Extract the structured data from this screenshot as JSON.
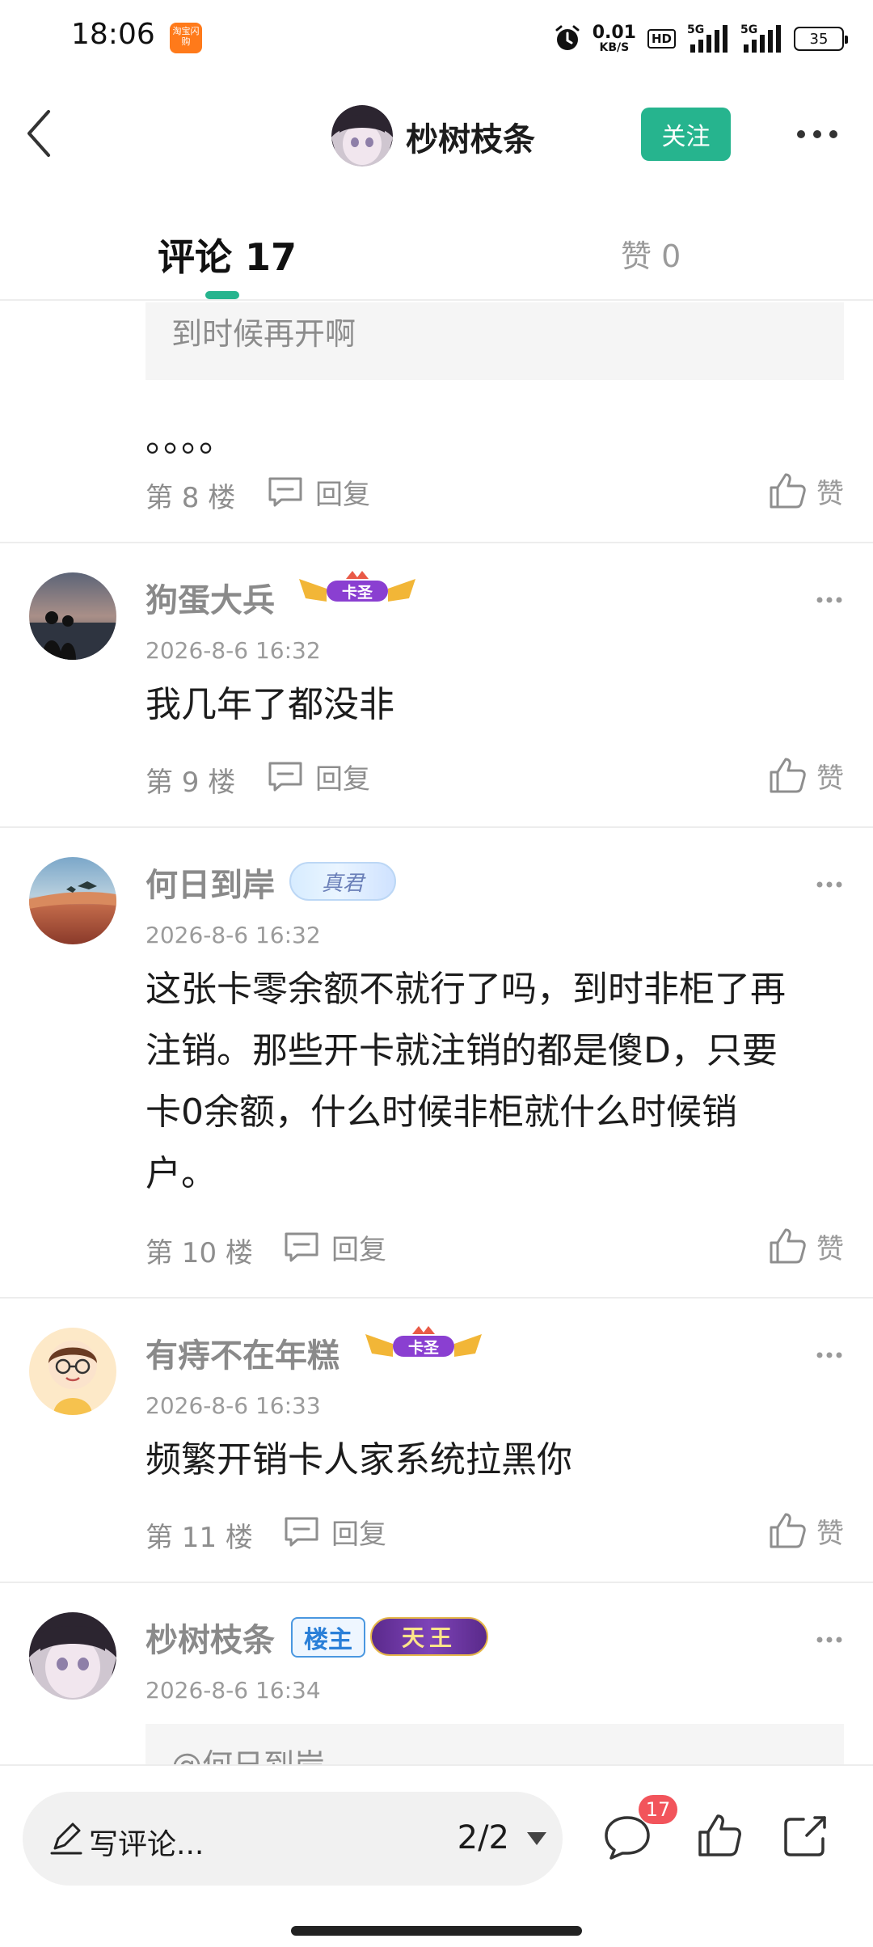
{
  "status_bar": {
    "time": "18:06",
    "app_icon_text": "淘宝闪购",
    "net_speed_value": "0.01",
    "net_speed_unit": "KB/S",
    "hd_label": "HD",
    "signal_1_label": "5G",
    "signal_2_label": "5G",
    "battery": "35"
  },
  "navbar": {
    "title": "杪树枝条",
    "follow_label": "关注"
  },
  "tabs": {
    "comments_label": "评论 17",
    "likes_label": "赞 0"
  },
  "posts": [
    {
      "quote": "到时候再开啊",
      "text": "。。。。",
      "floor": "第 8 楼",
      "reply_label": "回复",
      "like_label": "赞"
    },
    {
      "username": "狗蛋大兵",
      "badge": "卡圣",
      "time": "2026-8-6 16:32",
      "text": "我几年了都没非",
      "floor": "第 9 楼",
      "reply_label": "回复",
      "like_label": "赞"
    },
    {
      "username": "何日到岸",
      "badge": "真君",
      "time": "2026-8-6 16:32",
      "text_lines": [
        "这张卡零余额不就行了吗，到时非柜了再",
        "注销。那些开卡就注销的都是傻D，只要",
        "卡0余额，什么时候非柜就什么时候销",
        "户。"
      ],
      "floor": "第 10 楼",
      "reply_label": "回复",
      "like_label": "赞"
    },
    {
      "username": "有痔不在年糕",
      "badge": "卡圣",
      "time": "2026-8-6 16:33",
      "text": "频繁开销卡人家系统拉黑你",
      "floor": "第 11 楼",
      "reply_label": "回复",
      "like_label": "赞"
    },
    {
      "username": "杪树枝条",
      "owner_badge": "楼主",
      "badge": "天王",
      "time": "2026-8-6 16:34",
      "quote": "@何日到岸"
    }
  ],
  "bottom_bar": {
    "input_placeholder": "写评论...",
    "page_indicator": "2/2",
    "comment_count": "17"
  },
  "colors": {
    "accent": "#26b48e",
    "badge_red": "#f2545b",
    "muted_text": "#8e8e8e"
  },
  "icons": [
    "back-icon",
    "more-icon",
    "reply-icon",
    "like-icon",
    "dots-icon",
    "pen-icon",
    "caret-down-icon",
    "comment-bubble-icon",
    "thumb-icon",
    "share-icon"
  ]
}
